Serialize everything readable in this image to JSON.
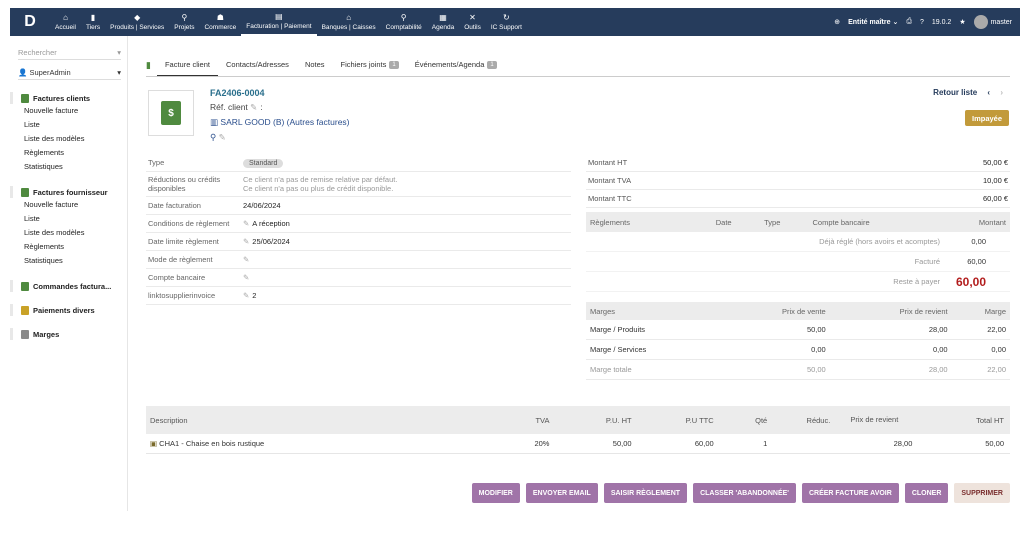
{
  "topbar": {
    "logo": "D",
    "nav": [
      {
        "icon": "⌂",
        "label": "Accueil"
      },
      {
        "icon": "▮",
        "label": "Tiers"
      },
      {
        "icon": "◆",
        "label": "Produits | Services"
      },
      {
        "icon": "⚲",
        "label": "Projets"
      },
      {
        "icon": "☗",
        "label": "Commerce"
      },
      {
        "icon": "▤",
        "label": "Facturation | Paiement"
      },
      {
        "icon": "⌂",
        "label": "Banques | Caisses"
      },
      {
        "icon": "⚲",
        "label": "Comptabilité"
      },
      {
        "icon": "▦",
        "label": "Agenda"
      },
      {
        "icon": "✕",
        "label": "Outils"
      },
      {
        "icon": "↻",
        "label": "IC Support"
      }
    ],
    "entity": "Entité maître ⌄",
    "version": "19.0.2",
    "user": "master"
  },
  "sidebar": {
    "search_placeholder": "Rechercher",
    "user": "SuperAdmin",
    "sections": [
      {
        "title": "Factures clients",
        "color": "#4f8a3f",
        "items": [
          "Nouvelle facture",
          "Liste",
          "Liste des modèles",
          "Règlements",
          "Statistiques"
        ]
      },
      {
        "title": "Factures fournisseur",
        "color": "#4f8a3f",
        "items": [
          "Nouvelle facture",
          "Liste",
          "Liste des modèles",
          "Règlements",
          "Statistiques"
        ]
      },
      {
        "title": "Commandes factura...",
        "color": "#4f8a3f",
        "items": []
      },
      {
        "title": "Paiements divers",
        "color": "#c9a227",
        "items": []
      },
      {
        "title": "Marges",
        "color": "#8a8a8a",
        "items": []
      }
    ]
  },
  "tabs": [
    {
      "label": "Facture client",
      "badge": ""
    },
    {
      "label": "Contacts/Adresses",
      "badge": ""
    },
    {
      "label": "Notes",
      "badge": ""
    },
    {
      "label": "Fichiers joints",
      "badge": "1"
    },
    {
      "label": "Événements/Agenda",
      "badge": "1"
    }
  ],
  "invoice": {
    "ref": "FA2406-0004",
    "ref_client_label": "Réf. client",
    "customer": "SARL GOOD (B) (Autres factures)",
    "back": "Retour liste",
    "status": "Impayée"
  },
  "fields": [
    {
      "label": "Type",
      "value": "Standard",
      "pill": true,
      "edit": false,
      "muted": false
    },
    {
      "label": "Réductions ou crédits disponibles",
      "value": "Ce client n'a pas de remise relative par défaut.\nCe client n'a pas ou plus de crédit disponible.",
      "pill": false,
      "edit": false,
      "muted": true
    },
    {
      "label": "Date facturation",
      "value": "24/06/2024",
      "pill": false,
      "edit": false,
      "muted": false
    },
    {
      "label": "Conditions de règlement",
      "value": "A réception",
      "pill": false,
      "edit": true,
      "muted": false
    },
    {
      "label": "Date limite règlement",
      "value": "25/06/2024",
      "pill": false,
      "edit": true,
      "muted": false
    },
    {
      "label": "Mode de règlement",
      "value": "",
      "pill": false,
      "edit": true,
      "muted": false
    },
    {
      "label": "Compte bancaire",
      "value": "",
      "pill": false,
      "edit": true,
      "muted": false
    },
    {
      "label": "linktosupplierinvoice",
      "value": "2",
      "pill": false,
      "edit": true,
      "muted": false
    }
  ],
  "amounts": [
    {
      "label": "Montant HT",
      "value": "50,00 €"
    },
    {
      "label": "Montant TVA",
      "value": "10,00 €"
    },
    {
      "label": "Montant TTC",
      "value": "60,00 €"
    }
  ],
  "payments": {
    "headers": [
      "Règlements",
      "Date",
      "Type",
      "Compte bancaire",
      "Montant"
    ],
    "deja_label": "Déjà réglé (hors avoirs et acomptes)",
    "deja_value": "0,00",
    "facture_label": "Facturé",
    "facture_value": "60,00",
    "reste_label": "Reste à payer",
    "reste_value": "60,00"
  },
  "marges": {
    "headers": [
      "Marges",
      "Prix de vente",
      "Prix de revient",
      "Marge"
    ],
    "rows": [
      {
        "label": "Marge / Produits",
        "vente": "50,00",
        "revient": "28,00",
        "marge": "22,00",
        "muted": false
      },
      {
        "label": "Marge / Services",
        "vente": "0,00",
        "revient": "0,00",
        "marge": "0,00",
        "muted": false
      },
      {
        "label": "Marge totale",
        "vente": "50,00",
        "revient": "28,00",
        "marge": "22,00",
        "muted": true
      }
    ]
  },
  "lines": {
    "headers": [
      "Description",
      "TVA",
      "P.U. HT",
      "P.U TTC",
      "Qté",
      "Réduc.",
      "Prix de revient",
      "Total HT"
    ],
    "rows": [
      {
        "desc": "CHA1 - Chaise en bois rustique",
        "tva": "20%",
        "puht": "50,00",
        "puttc": "60,00",
        "qte": "1",
        "reduc": "",
        "revient": "28,00",
        "total": "50,00"
      }
    ]
  },
  "buttons": [
    "MODIFIER",
    "ENVOYER EMAIL",
    "SAISIR RÈGLEMENT",
    "CLASSER 'ABANDONNÉE'",
    "CRÉER FACTURE AVOIR",
    "CLONER",
    "SUPPRIMER"
  ]
}
